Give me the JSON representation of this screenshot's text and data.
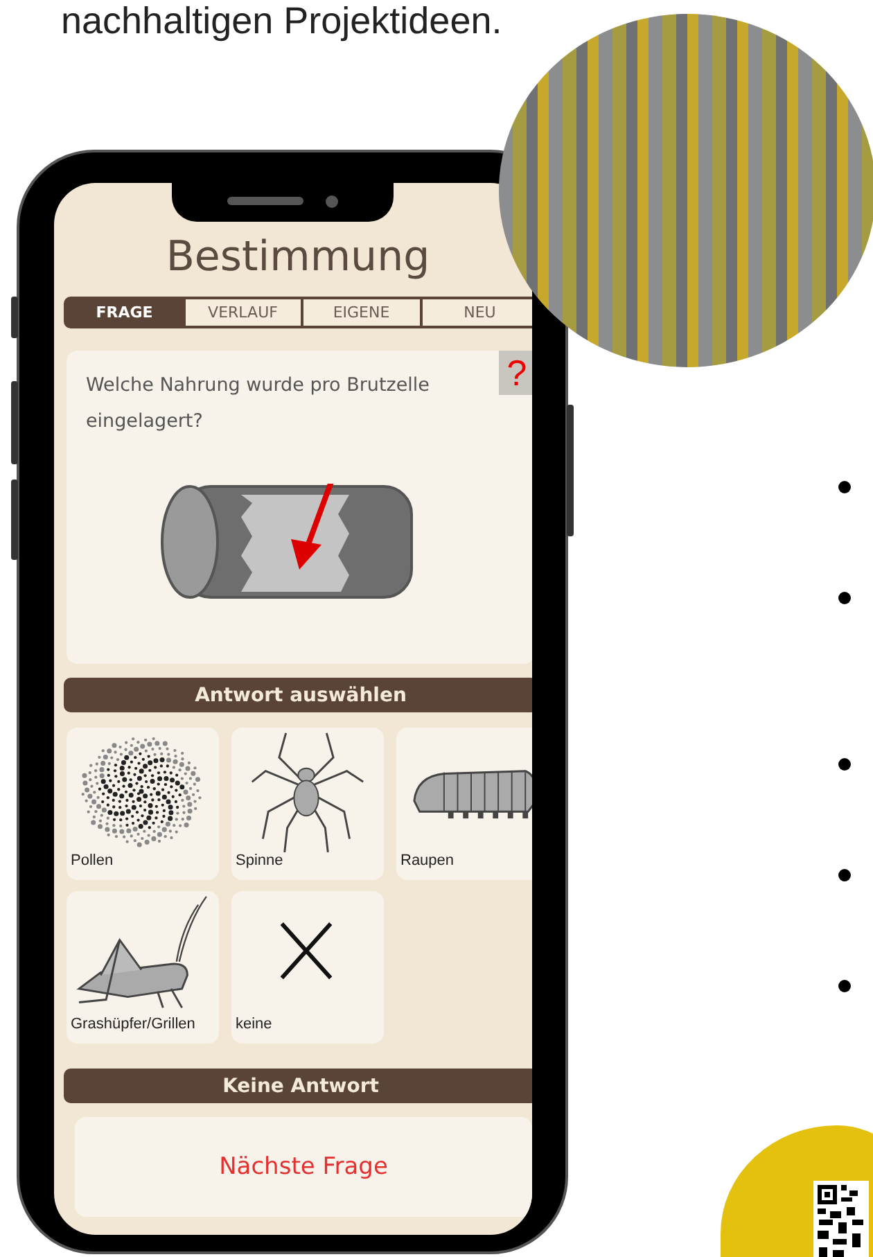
{
  "heading": "nachhaltigen Projektideen.",
  "app": {
    "title": "Bestimmung",
    "tabs": [
      {
        "label": "FRAGE",
        "selected": true
      },
      {
        "label": "VERLAUF",
        "selected": false
      },
      {
        "label": "EIGENE",
        "selected": false
      },
      {
        "label": "NEU",
        "selected": false
      }
    ],
    "help_button": "?",
    "question": "Welche Nahrung wurde pro Brutzelle eingelagert?",
    "answer_header": "Antwort auswählen",
    "answers": [
      {
        "label": "Pollen",
        "kind": "pollen"
      },
      {
        "label": "Spinne",
        "kind": "spider"
      },
      {
        "label": "Raupen",
        "kind": "caterpillar"
      },
      {
        "label": "Grashüpfer/Grillen",
        "kind": "grasshopper"
      },
      {
        "label": "keine",
        "kind": "none"
      }
    ],
    "no_answer_button": "Keine Antwort",
    "next_button": "Nächste Frage"
  }
}
